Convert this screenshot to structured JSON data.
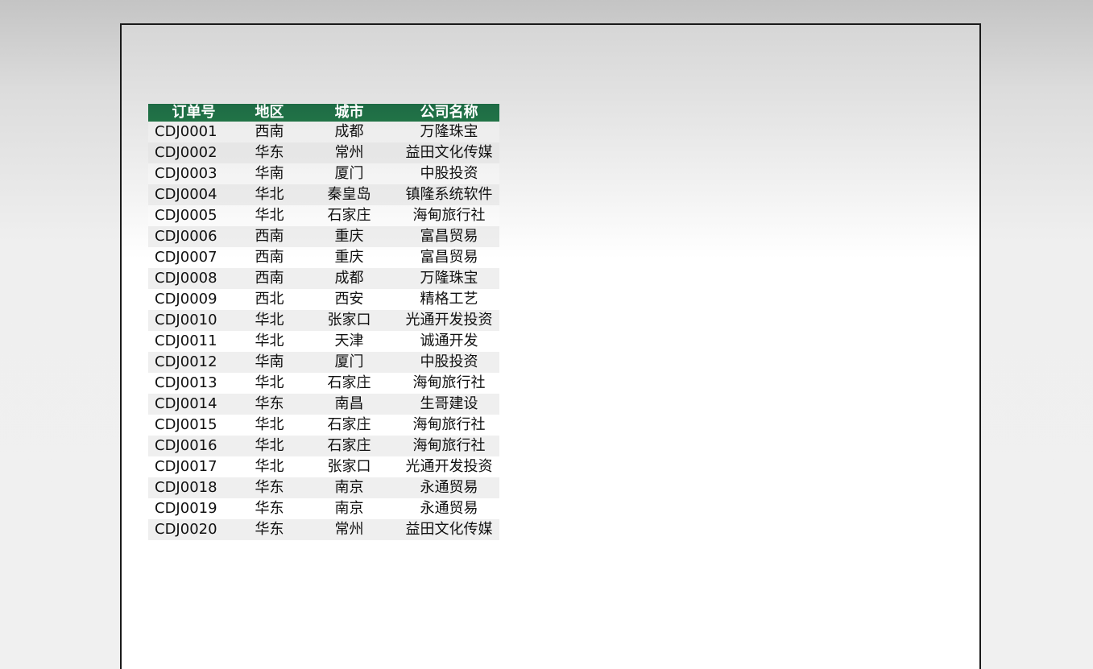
{
  "table": {
    "header_color": "#217346",
    "columns": [
      "订单号",
      "地区",
      "城市",
      "公司名称"
    ],
    "rows": [
      [
        "CDJ0001",
        "西南",
        "成都",
        "万隆珠宝"
      ],
      [
        "CDJ0002",
        "华东",
        "常州",
        "益田文化传媒"
      ],
      [
        "CDJ0003",
        "华南",
        "厦门",
        "中股投资"
      ],
      [
        "CDJ0004",
        "华北",
        "秦皇岛",
        "镇隆系统软件"
      ],
      [
        "CDJ0005",
        "华北",
        "石家庄",
        "海甸旅行社"
      ],
      [
        "CDJ0006",
        "西南",
        "重庆",
        "富昌贸易"
      ],
      [
        "CDJ0007",
        "西南",
        "重庆",
        "富昌贸易"
      ],
      [
        "CDJ0008",
        "西南",
        "成都",
        "万隆珠宝"
      ],
      [
        "CDJ0009",
        "西北",
        "西安",
        "精格工艺"
      ],
      [
        "CDJ0010",
        "华北",
        "张家口",
        "光通开发投资"
      ],
      [
        "CDJ0011",
        "华北",
        "天津",
        "诚通开发"
      ],
      [
        "CDJ0012",
        "华南",
        "厦门",
        "中股投资"
      ],
      [
        "CDJ0013",
        "华北",
        "石家庄",
        "海甸旅行社"
      ],
      [
        "CDJ0014",
        "华东",
        "南昌",
        "生哥建设"
      ],
      [
        "CDJ0015",
        "华北",
        "石家庄",
        "海甸旅行社"
      ],
      [
        "CDJ0016",
        "华北",
        "石家庄",
        "海甸旅行社"
      ],
      [
        "CDJ0017",
        "华北",
        "张家口",
        "光通开发投资"
      ],
      [
        "CDJ0018",
        "华东",
        "南京",
        "永通贸易"
      ],
      [
        "CDJ0019",
        "华东",
        "南京",
        "永通贸易"
      ],
      [
        "CDJ0020",
        "华东",
        "常州",
        "益田文化传媒"
      ]
    ]
  }
}
